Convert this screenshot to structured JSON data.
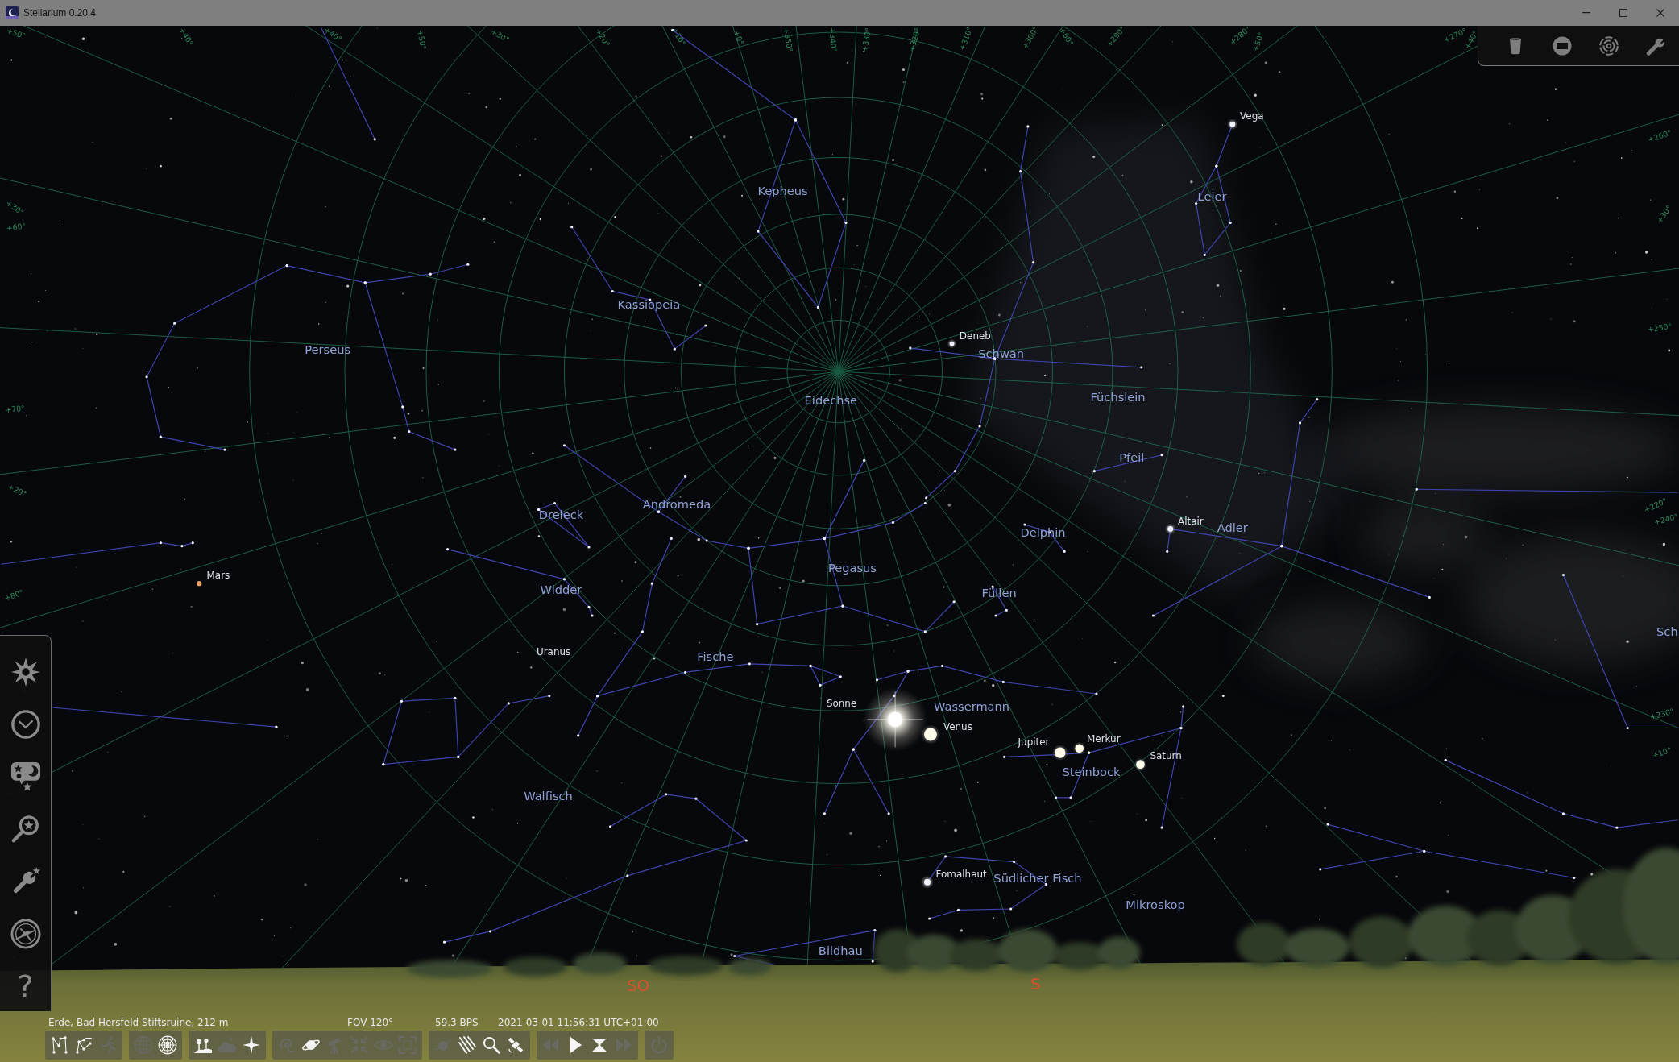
{
  "window": {
    "title": "Stellarium 0.20.4"
  },
  "plugin_toolbar": {
    "buttons": [
      {
        "kind": "cylinder"
      },
      {
        "kind": "screen"
      },
      {
        "kind": "target"
      },
      {
        "kind": "wrench"
      }
    ]
  },
  "sky": {
    "grid_labels": [
      "+50°",
      "+40°",
      "+40°",
      "+50°",
      "+30°",
      "+20°",
      "+10°",
      "+0°",
      "+350°",
      "+340°",
      "+330°",
      "+320°",
      "+310°",
      "+300°",
      "+60°",
      "+290°",
      "+280°",
      "+50°",
      "+270°",
      "+40°",
      "+30°",
      "+60°",
      "+70°",
      "+20°",
      "+80°",
      "+260°",
      "+30°",
      "+250°",
      "+220°",
      "+240°",
      "+230°",
      "+10°"
    ],
    "constellations": [
      "Kepheus",
      "Leier",
      "Kassiopeia",
      "Perseus",
      "Schwan",
      "Füchslein",
      "Eidechse",
      "Pfeil",
      "Andromeda",
      "Dreieck",
      "Adler",
      "Delphin",
      "Pegasus",
      "Widder",
      "Füllen",
      "Sch",
      "Fische",
      "Wassermann",
      "Steinbock",
      "Walfisch",
      "Südlicher Fisch",
      "Mikroskop",
      "Bildhau"
    ],
    "objects": [
      {
        "name": "Vega",
        "kind": "star"
      },
      {
        "name": "Deneb",
        "kind": "star"
      },
      {
        "name": "Altair",
        "kind": "star"
      },
      {
        "name": "Mars",
        "kind": "planet"
      },
      {
        "name": "Uranus",
        "kind": "planet"
      },
      {
        "name": "Sonne",
        "kind": "sun"
      },
      {
        "name": "Venus",
        "kind": "planet"
      },
      {
        "name": "Merkur",
        "kind": "planet"
      },
      {
        "name": "Jupiter",
        "kind": "planet"
      },
      {
        "name": "Saturn",
        "kind": "planet"
      },
      {
        "name": "Fomalhaut",
        "kind": "star"
      }
    ],
    "cardinal_points": [
      "SO",
      "S"
    ]
  },
  "side_panel": {
    "buttons": [
      {
        "kind": "location"
      },
      {
        "kind": "time"
      },
      {
        "kind": "sky-options"
      },
      {
        "kind": "search"
      },
      {
        "kind": "settings"
      },
      {
        "kind": "calculations"
      },
      {
        "kind": "help",
        "label": "?"
      }
    ]
  },
  "status_bar": {
    "location": "Erde, Bad Hersfeld Stiftsruine, 212 m",
    "fov": "FOV 120°",
    "fps": "59.3 BPS",
    "date_time": "2021-03-01 11:56:31 UTC+01:00"
  },
  "toolbar": {
    "groups": [
      {
        "buttons": [
          {
            "kind": "constellation-lines",
            "on": true
          },
          {
            "kind": "constellation-labels",
            "on": true
          },
          {
            "kind": "constellation-art",
            "on": false
          }
        ]
      },
      {
        "buttons": [
          {
            "kind": "equatorial-grid",
            "on": false
          },
          {
            "kind": "azimuthal-grid",
            "on": true
          }
        ]
      },
      {
        "buttons": [
          {
            "kind": "ground",
            "on": true
          },
          {
            "kind": "atmosphere",
            "on": false
          },
          {
            "kind": "cardinal-points",
            "on": true
          }
        ]
      },
      {
        "buttons": [
          {
            "kind": "nebulae",
            "on": false
          },
          {
            "kind": "planets",
            "on": true
          },
          {
            "kind": "telescope",
            "on": false
          },
          {
            "kind": "inward-arrows",
            "on": false
          },
          {
            "kind": "eye",
            "on": false
          },
          {
            "kind": "frame",
            "on": false
          }
        ]
      },
      {
        "buttons": [
          {
            "kind": "planet-orbit",
            "on": false
          },
          {
            "kind": "meteor",
            "on": true
          },
          {
            "kind": "search",
            "on": true
          },
          {
            "kind": "satellite",
            "on": true
          }
        ]
      },
      {
        "buttons": [
          {
            "kind": "rewind",
            "on": false
          },
          {
            "kind": "play",
            "on": true
          },
          {
            "kind": "now",
            "on": true
          },
          {
            "kind": "fast-forward",
            "on": false
          }
        ]
      },
      {
        "buttons": [
          {
            "kind": "quit",
            "on": false
          }
        ]
      }
    ]
  }
}
